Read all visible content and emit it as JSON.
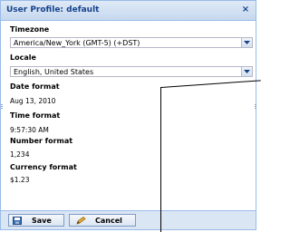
{
  "dialog": {
    "title": "User Profile: default",
    "close_symbol": "×"
  },
  "fields": {
    "timezone": {
      "label": "Timezone",
      "value": "America/New_York (GMT-5) (+DST)"
    },
    "locale": {
      "label": "Locale",
      "value": "English, United States"
    },
    "date_format": {
      "label": "Date format",
      "value": "Aug 13, 2010"
    },
    "time_format": {
      "label": "Time format",
      "value": "9:57:30 AM"
    },
    "number_format": {
      "label": "Number format",
      "value": "1,234"
    },
    "currency_format": {
      "label": "Currency format",
      "value": "$1.23"
    }
  },
  "buttons": {
    "save": {
      "label": "Save",
      "icon": "floppy-disk-icon"
    },
    "cancel": {
      "label": "Cancel",
      "icon": "pencil-cancel-icon"
    }
  },
  "colors": {
    "title_text": "#15428b",
    "border": "#99bbe8",
    "footer_bg": "#dbe6f4"
  }
}
